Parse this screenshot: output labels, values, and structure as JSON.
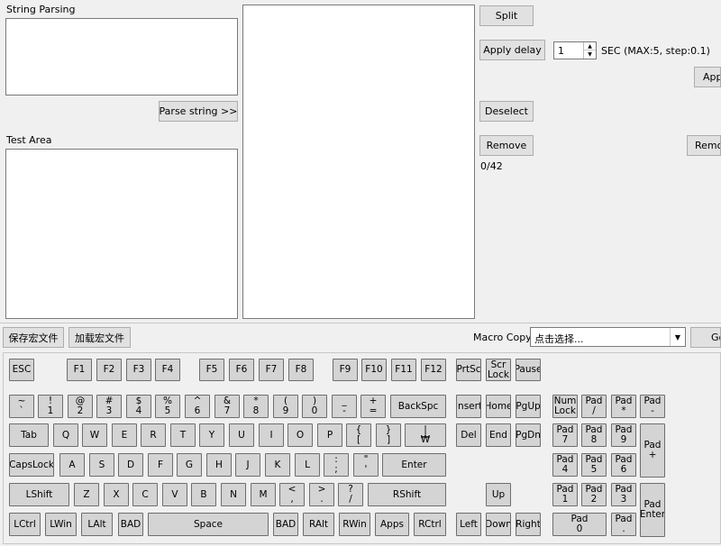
{
  "top": {
    "string_parsing_label": "String Parsing",
    "parse_button": "Parse string >>",
    "test_area_label": "Test Area",
    "split_button": "Split",
    "apply_delay_button": "Apply delay",
    "delay_value": "1",
    "delay_hint": "SEC (MAX:5, step:0.1)",
    "apply_all_button": "Apply",
    "deselect_button": "Deselect",
    "remove_button": "Remove",
    "remove_all_button": "Remove",
    "count": "0/42"
  },
  "toolbar": {
    "save_macro": "保存宏文件",
    "load_macro": "加载宏文件",
    "macro_copy_label": "Macro Copy:",
    "macro_copy_value": "点击选择...",
    "go_button": "Go"
  },
  "keys": {
    "esc": "ESC",
    "f1": "F1",
    "f2": "F2",
    "f3": "F3",
    "f4": "F4",
    "f5": "F5",
    "f6": "F6",
    "f7": "F7",
    "f8": "F8",
    "f9": "F9",
    "f10": "F10",
    "f11": "F11",
    "f12": "F12",
    "prtsc": "PrtSc",
    "scr_top": "Scr",
    "scr_bottom": "Lock",
    "pause": "Pause",
    "tilde_top": "~",
    "tilde_bottom": "`",
    "n1_top": "!",
    "n1_bottom": "1",
    "n2_top": "@",
    "n2_bottom": "2",
    "n3_top": "#",
    "n3_bottom": "3",
    "n4_top": "$",
    "n4_bottom": "4",
    "n5_top": "%",
    "n5_bottom": "5",
    "n6_top": "^",
    "n6_bottom": "6",
    "n7_top": "&",
    "n7_bottom": "7",
    "n8_top": "*",
    "n8_bottom": "8",
    "n9_top": "(",
    "n9_bottom": "9",
    "n0_top": ")",
    "n0_bottom": "0",
    "minus_top": "_",
    "minus_bottom": "-",
    "equal_top": "+",
    "equal_bottom": "=",
    "backspace": "BackSpc",
    "insert": "Insert",
    "home": "Home",
    "pgup": "PgUp",
    "numlock_top": "Num",
    "numlock_bottom": "Lock",
    "pad_div_top": "Pad",
    "pad_div_bottom": "/",
    "pad_mul_top": "Pad",
    "pad_mul_bottom": "*",
    "pad_sub_top": "Pad",
    "pad_sub_bottom": "-",
    "tab": "Tab",
    "q": "Q",
    "w": "W",
    "e": "E",
    "r": "R",
    "t": "T",
    "y": "Y",
    "u": "U",
    "i": "I",
    "o": "O",
    "p": "P",
    "lbracket_top": "{",
    "lbracket_bottom": "[",
    "rbracket_top": "}",
    "rbracket_bottom": "]",
    "backslash_top": "|",
    "backslash_bottom": "₩",
    "del": "Del",
    "end": "End",
    "pgdn": "PgDn",
    "pad7_top": "Pad",
    "pad7_bottom": "7",
    "pad8_top": "Pad",
    "pad8_bottom": "8",
    "pad9_top": "Pad",
    "pad9_bottom": "9",
    "padplus_top": "Pad",
    "padplus_bottom": "+",
    "capslock": "CapsLock",
    "a": "A",
    "s": "S",
    "d": "D",
    "f": "F",
    "g": "G",
    "h": "H",
    "j": "J",
    "k": "K",
    "l": "L",
    "semi_top": ":",
    "semi_bottom": ";",
    "quote_top": "\"",
    "quote_bottom": "'",
    "enter": "Enter",
    "pad4_top": "Pad",
    "pad4_bottom": "4",
    "pad5_top": "Pad",
    "pad5_bottom": "5",
    "pad6_top": "Pad",
    "pad6_bottom": "6",
    "lshift": "LShift",
    "z": "Z",
    "x": "X",
    "c": "C",
    "v": "V",
    "b": "B",
    "n": "N",
    "m": "M",
    "comma_top": "<",
    "comma_bottom": ",",
    "period_top": ">",
    "period_bottom": ".",
    "slash_top": "?",
    "slash_bottom": "/",
    "rshift": "RShift",
    "up": "Up",
    "pad1_top": "Pad",
    "pad1_bottom": "1",
    "pad2_top": "Pad",
    "pad2_bottom": "2",
    "pad3_top": "Pad",
    "pad3_bottom": "3",
    "padenter_top": "Pad",
    "padenter_bottom": "Enter",
    "lctrl": "LCtrl",
    "lwin": "LWin",
    "lalt": "LAlt",
    "bad1": "BAD",
    "space": "Space",
    "bad2": "BAD",
    "ralt": "RAlt",
    "rwin": "RWin",
    "apps": "Apps",
    "rctrl": "RCtrl",
    "left": "Left",
    "down": "Down",
    "right": "Right",
    "pad0_top": "Pad",
    "pad0_bottom": "0",
    "paddot_top": "Pad",
    "paddot_bottom": "."
  }
}
